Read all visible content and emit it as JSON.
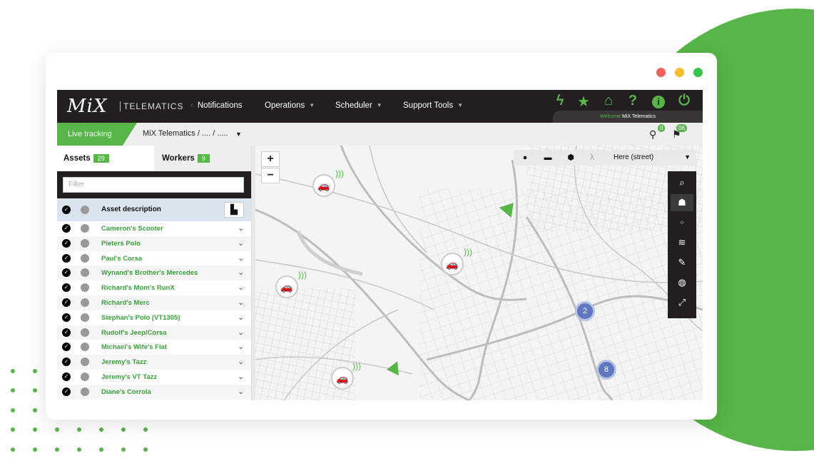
{
  "app": {
    "logo": "MiX",
    "logo_sub": "TELEMATICS",
    "nav": {
      "notifications": "Notifications",
      "operations": "Operations",
      "scheduler": "Scheduler",
      "support_tools": "Support Tools"
    },
    "welcome_label": "Welcome",
    "welcome_name": "MiX Telematics",
    "live_tracking": "Live tracking",
    "breadcrumb": "MiX Telematics / .... / .....",
    "pin_count": "0",
    "flag_count": "06"
  },
  "assets_panel": {
    "tab_assets": "Assets",
    "assets_count": "29",
    "tab_workers": "Workers",
    "workers_count": "9",
    "filter_placeholder": "Filter",
    "column_header": "Asset description",
    "items": [
      "Cameron's Scooter",
      "Pieters Polo",
      "Paul's Corsa",
      "Wynand's Brother's Mercedes",
      "Richard's Mom's RunX",
      "Richard's Merc",
      "Stephan's Polo (VT1305)",
      "Rudolf's Jeep/Corsa",
      "Michael's Wife's Fiat",
      "Jeremy's Tazz",
      "Jeremy's VT Tazz",
      "Diane's Corrola"
    ]
  },
  "map": {
    "zoom_in": "+",
    "zoom_out": "−",
    "layer_select": "Here (street)",
    "clusters": [
      "2",
      "8"
    ],
    "tools": [
      "search-icon",
      "home-icon",
      "crosshair-icon",
      "layers-icon",
      "wrench-icon",
      "globe-icon",
      "fullscreen-icon"
    ]
  },
  "colors": {
    "brand_green": "#56b647",
    "topbar_dark": "#231f20",
    "cluster_blue": "#5f78bf"
  }
}
